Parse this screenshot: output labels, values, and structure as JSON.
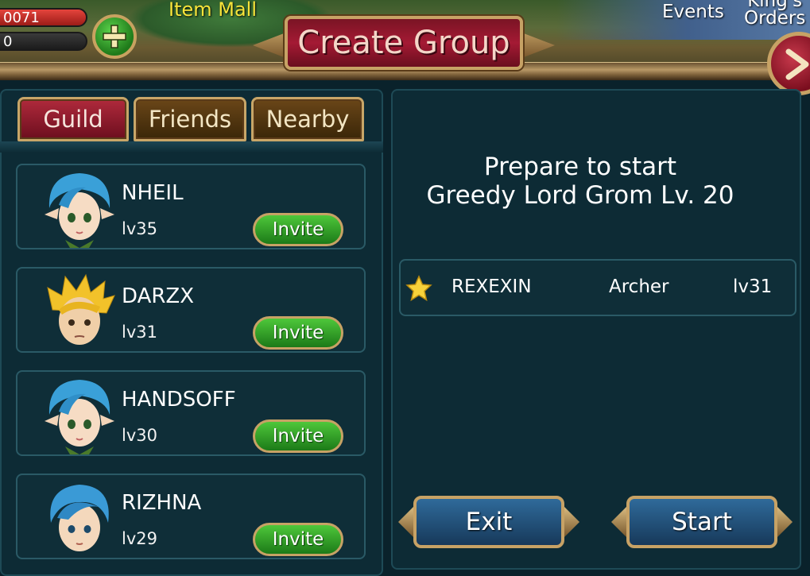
{
  "header": {
    "currency_top": "0071",
    "currency_bottom": "0",
    "item_mall": "Item Mall",
    "title": "Create Group",
    "events": "Events",
    "kings_orders_line1": "King's",
    "kings_orders_line2": "Orders"
  },
  "tabs": [
    {
      "label": "Guild",
      "active": true
    },
    {
      "label": "Friends",
      "active": false
    },
    {
      "label": "Nearby",
      "active": false
    }
  ],
  "friends": [
    {
      "name": "NHEIL",
      "level": "lv35",
      "button": "Invite",
      "avatar": "blue-haired-elf-girl"
    },
    {
      "name": "DARZX",
      "level": "lv31",
      "button": "Invite",
      "avatar": "blonde-spiky-boy"
    },
    {
      "name": "HANDSOFF",
      "level": "lv30",
      "button": "Invite",
      "avatar": "blue-haired-elf-girl"
    },
    {
      "name": "RIZHNA",
      "level": "lv29",
      "button": "Invite",
      "avatar": "blue-haired-boy"
    }
  ],
  "group": {
    "prepare_line1": "Prepare to start",
    "prepare_line2": "Greedy Lord Grom Lv. 20",
    "members": [
      {
        "name": "REXEXIN",
        "class": "Archer",
        "level": "lv31",
        "leader": true
      }
    ],
    "exit_label": "Exit",
    "start_label": "Start"
  },
  "colors": {
    "panel_bg": "#0d2b35",
    "tab_active": "#9c1c30",
    "invite_green": "#3aa82c",
    "button_blue": "#24507a",
    "gold_trim": "#c7a265"
  }
}
